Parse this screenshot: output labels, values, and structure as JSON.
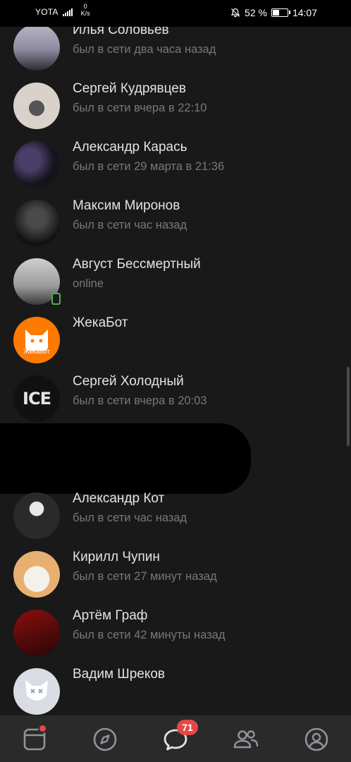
{
  "status_bar": {
    "carrier": "YOTA",
    "net_speed_value": "0",
    "net_speed_unit": "K/s",
    "battery": "52 %",
    "battery_level": 0.52,
    "time": "14:07"
  },
  "contacts": [
    {
      "name": "Илья Соловьев",
      "status": "был в сети два часа назад"
    },
    {
      "name": "Сергей Кудрявцев",
      "status": "был в сети вчера в 22:10"
    },
    {
      "name": "Александр Карась",
      "status": "был в сети 29 марта в 21:36"
    },
    {
      "name": "Максим Миронов",
      "status": "был в сети час назад"
    },
    {
      "name": "Август Бессмертный",
      "status": "online"
    },
    {
      "name": "ЖекаБот",
      "status": "",
      "avatar_label": "ЖекаБот"
    },
    {
      "name": "Сергей Холодный",
      "status": "был в сети вчера в 20:03",
      "avatar_label": "ICE"
    },
    {
      "name": "Александр Кот",
      "status": "был в сети час назад"
    },
    {
      "name": "Кирилл Чупин",
      "status": "был в сети 27 минут назад"
    },
    {
      "name": "Артём Граф",
      "status": "был в сети 42 минуты назад"
    },
    {
      "name": "Вадим Шреков",
      "status": ""
    }
  ],
  "tabbar": {
    "tabs": [
      {
        "icon": "news-icon",
        "has_dot": true
      },
      {
        "icon": "explore-compass-icon"
      },
      {
        "icon": "messages-icon",
        "badge": "71",
        "active": true
      },
      {
        "icon": "friends-icon"
      },
      {
        "icon": "profile-icon"
      }
    ]
  },
  "colors": {
    "background": "#19191a",
    "name_text": "#e1e3e6",
    "status_text": "#76787a",
    "badge": "#e64646",
    "online": "#4bb34b",
    "tabbar": "#2a2a2b"
  }
}
